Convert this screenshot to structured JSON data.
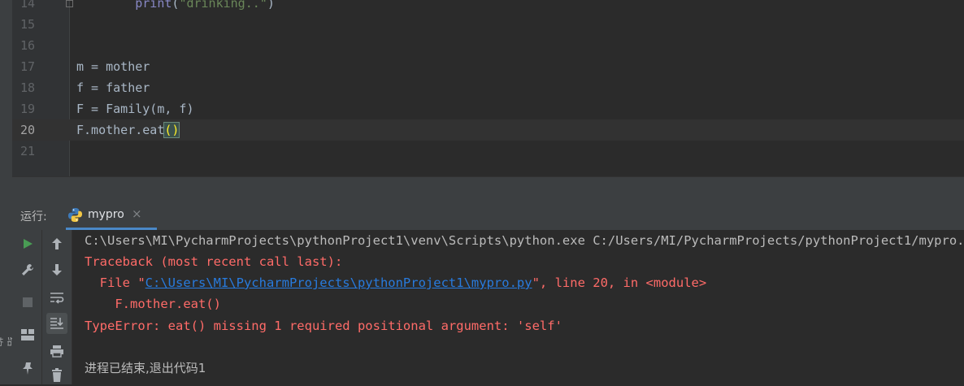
{
  "editor": {
    "lines": [
      {
        "num": "14",
        "text": "        print(\"drinking..\")"
      },
      {
        "num": "15",
        "text": ""
      },
      {
        "num": "16",
        "text": ""
      },
      {
        "num": "17",
        "text": "m = mother"
      },
      {
        "num": "18",
        "text": "f = father"
      },
      {
        "num": "19",
        "text": "F = Family(m, f)"
      },
      {
        "num": "20",
        "text": "F.mother.eat()"
      },
      {
        "num": "21",
        "text": ""
      }
    ],
    "line14_print": "print",
    "line14_paren_open": "(",
    "line14_string": "\"drinking..\"",
    "line14_paren_close": ")",
    "line20_prefix": "F.mother.eat",
    "line20_parens": "()"
  },
  "run": {
    "label": "运行:",
    "tab_label": "mypro",
    "tab_close": "×"
  },
  "console": {
    "command": "C:\\Users\\MI\\PycharmProjects\\pythonProject1\\venv\\Scripts\\python.exe C:/Users/MI/PycharmProjects/pythonProject1/mypro.py",
    "traceback": "Traceback (most recent call last):",
    "file_prefix": "  File \"",
    "file_link": "C:\\Users\\MI\\PycharmProjects\\pythonProject1\\mypro.py",
    "file_suffix": "\", line 20, in <module>",
    "code_echo": "    F.mother.eat()",
    "error": "TypeError: eat() missing 1 required positional argument: 'self'",
    "exit": "进程已结束,退出代码1"
  },
  "colors": {
    "accent": "#4a88c7",
    "error": "#ff6b68",
    "link": "#287bde",
    "run_green": "#499c54"
  },
  "left_strip_text": "结构"
}
